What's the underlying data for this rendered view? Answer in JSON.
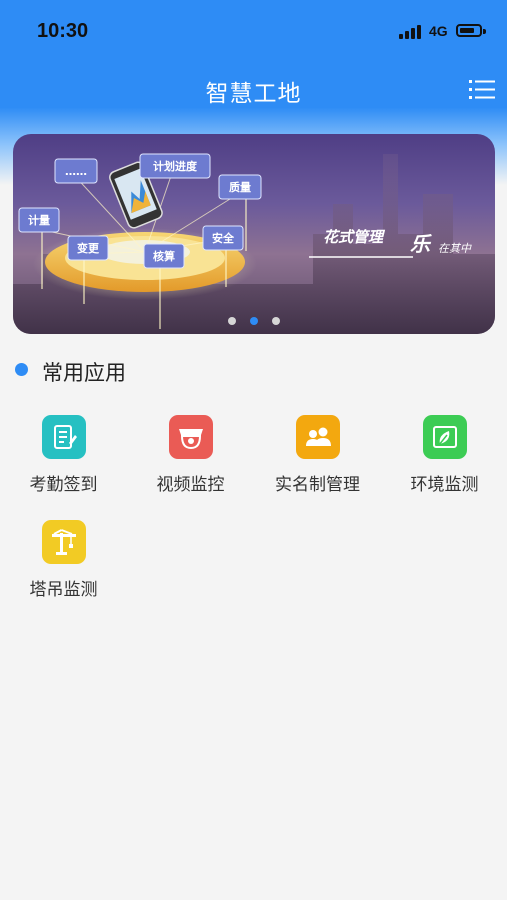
{
  "status_bar": {
    "time": "10:30",
    "network": "4G"
  },
  "header": {
    "title": "智慧工地",
    "menu_icon": "list-menu-icon"
  },
  "banner": {
    "slides": 3,
    "active_slide": 2,
    "image_tags": [
      "……",
      "计划进度",
      "质量",
      "计量",
      "变更",
      "核算",
      "安全"
    ],
    "slogan": {
      "part1": "花式管理",
      "part2": "乐",
      "part3": "在其中"
    }
  },
  "section": {
    "title": "常用应用",
    "accent": "#2e8cf5"
  },
  "apps": [
    {
      "label": "考勤签到",
      "icon": "attendance-icon",
      "color": "#26c0c2"
    },
    {
      "label": "视频监控",
      "icon": "camera-icon",
      "color": "#ea5b55"
    },
    {
      "label": "实名制管理",
      "icon": "workers-icon",
      "color": "#f3a80f"
    },
    {
      "label": "环境监测",
      "icon": "environment-icon",
      "color": "#3ccc54"
    },
    {
      "label": "塔吊监测",
      "icon": "tower-crane-icon",
      "color": "#f2cb24"
    }
  ]
}
